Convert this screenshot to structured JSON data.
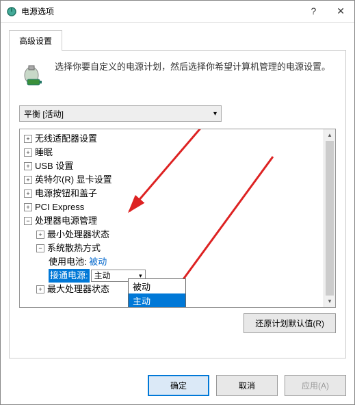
{
  "window": {
    "title": "电源选项"
  },
  "tabs": {
    "advanced": "高级设置"
  },
  "description": "选择你要自定义的电源计划，然后选择你希望计算机管理的电源设置。",
  "plan_select": {
    "value": "平衡 [活动]"
  },
  "tree": {
    "items": [
      {
        "label": "无线适配器设置",
        "expanded": false,
        "level": 0
      },
      {
        "label": "睡眠",
        "expanded": false,
        "level": 0
      },
      {
        "label": "USB 设置",
        "expanded": false,
        "level": 0
      },
      {
        "label": "英特尔(R) 显卡设置",
        "expanded": false,
        "level": 0
      },
      {
        "label": "电源按钮和盖子",
        "expanded": false,
        "level": 0
      },
      {
        "label": "PCI Express",
        "expanded": false,
        "level": 0
      },
      {
        "label": "处理器电源管理",
        "expanded": true,
        "level": 0
      },
      {
        "label": "最小处理器状态",
        "expanded": false,
        "level": 1
      },
      {
        "label": "系统散热方式",
        "expanded": true,
        "level": 1
      }
    ],
    "battery_label": "使用电池:",
    "battery_value": "被动",
    "plugged_label": "接通电源:",
    "plugged_value": "主动",
    "last_cut": "最大处理器状态"
  },
  "dropdown": {
    "options": [
      "被动",
      "主动"
    ],
    "selected": "主动"
  },
  "buttons": {
    "restore": "还原计划默认值(R)",
    "ok": "确定",
    "cancel": "取消",
    "apply": "应用(A)"
  }
}
